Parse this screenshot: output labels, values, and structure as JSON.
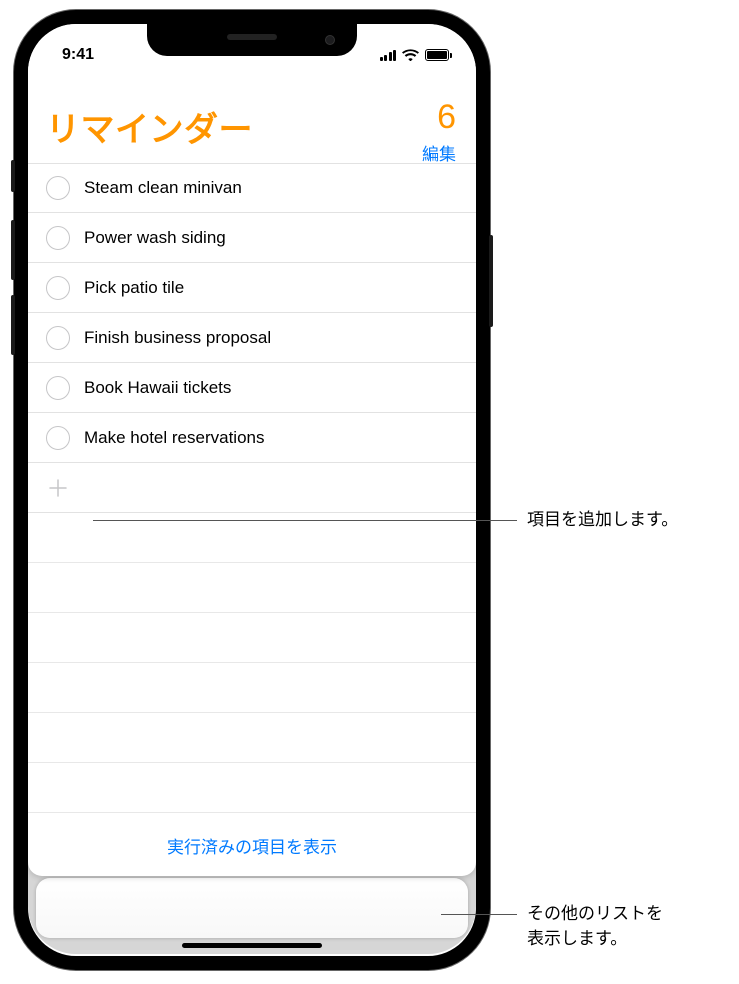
{
  "status": {
    "time": "9:41"
  },
  "header": {
    "title": "リマインダー",
    "count": "6",
    "edit": "編集"
  },
  "reminders": [
    {
      "text": "Steam clean minivan"
    },
    {
      "text": "Power wash siding"
    },
    {
      "text": "Pick patio tile"
    },
    {
      "text": "Finish business proposal"
    },
    {
      "text": "Book Hawaii tickets"
    },
    {
      "text": "Make hotel reservations"
    }
  ],
  "footer": {
    "show_completed": "実行済みの項目を表示"
  },
  "callouts": {
    "add_item": "項目を追加します。",
    "other_lists": "その他のリストを\n表示します。"
  }
}
